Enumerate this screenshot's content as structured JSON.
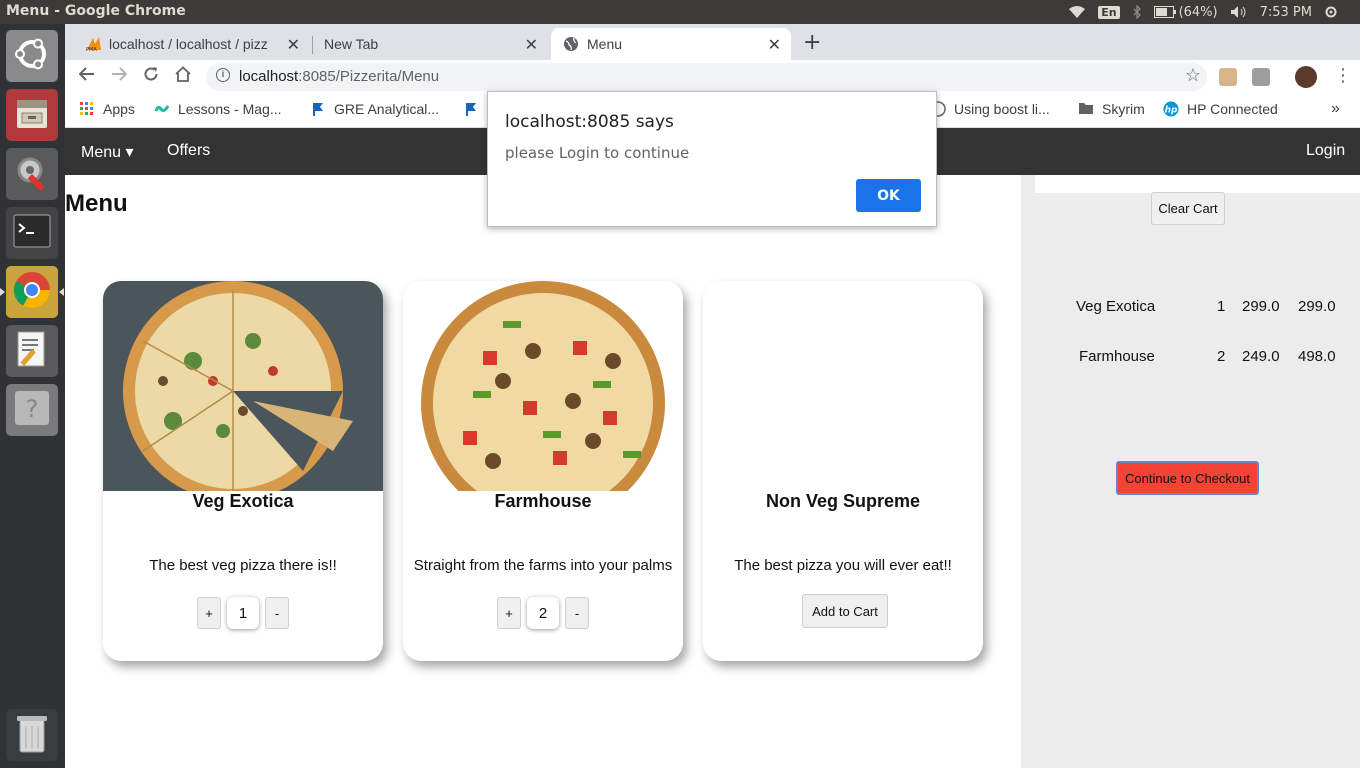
{
  "os": {
    "window_title": "Menu - Google Chrome",
    "tray": {
      "keyboard": "En",
      "battery": "(64%)",
      "clock": "7:53 PM"
    }
  },
  "browser": {
    "tabs": [
      {
        "label": "localhost / localhost / pizz",
        "icon": "phpmyadmin-icon"
      },
      {
        "label": "New Tab",
        "icon": ""
      },
      {
        "label": "Menu",
        "icon": "globe-icon"
      }
    ],
    "url_host": "localhost",
    "url_path": ":8085/Pizzerita/Menu",
    "bookmarks": [
      {
        "label": "Apps",
        "icon": "apps-grid-icon"
      },
      {
        "label": "Lessons - Mag...",
        "icon": "magoosh-icon"
      },
      {
        "label": "GRE Analytical...",
        "icon": "flag-icon"
      },
      {
        "label": "Using boost li...",
        "icon": "globe-icon"
      },
      {
        "label": "Skyrim",
        "icon": "folder-icon"
      },
      {
        "label": "HP Connected",
        "icon": "hp-icon"
      }
    ],
    "bookmarks_overflow": "»"
  },
  "site": {
    "nav": {
      "menu_label": "Menu ▾",
      "offers_label": "Offers",
      "login_label": "Login"
    },
    "page_title": "Menu",
    "cards": [
      {
        "name": "Veg Exotica",
        "description": "The best veg pizza there is!!",
        "quantity": "1",
        "plus": "+",
        "minus": "-"
      },
      {
        "name": "Farmhouse",
        "description": "Straight from the farms into your palms",
        "quantity": "2",
        "plus": "+",
        "minus": "-"
      },
      {
        "name": "Non Veg Supreme",
        "description": "The best pizza you will ever eat!!",
        "add_to_cart": "Add to Cart"
      }
    ],
    "cart": {
      "clear_label": "Clear Cart",
      "items": [
        {
          "name": "Veg Exotica",
          "qty": "1",
          "price": "299.0",
          "total": "299.0"
        },
        {
          "name": "Farmhouse",
          "qty": "2",
          "price": "249.0",
          "total": "498.0"
        }
      ],
      "checkout_label": "Continue to Checkout"
    }
  },
  "alert": {
    "title": "localhost:8085 says",
    "message": "please Login to continue",
    "ok_label": "OK"
  },
  "colors": {
    "navbar": "#333333",
    "checkout": "#f44336",
    "ok_button": "#1a73e8"
  }
}
